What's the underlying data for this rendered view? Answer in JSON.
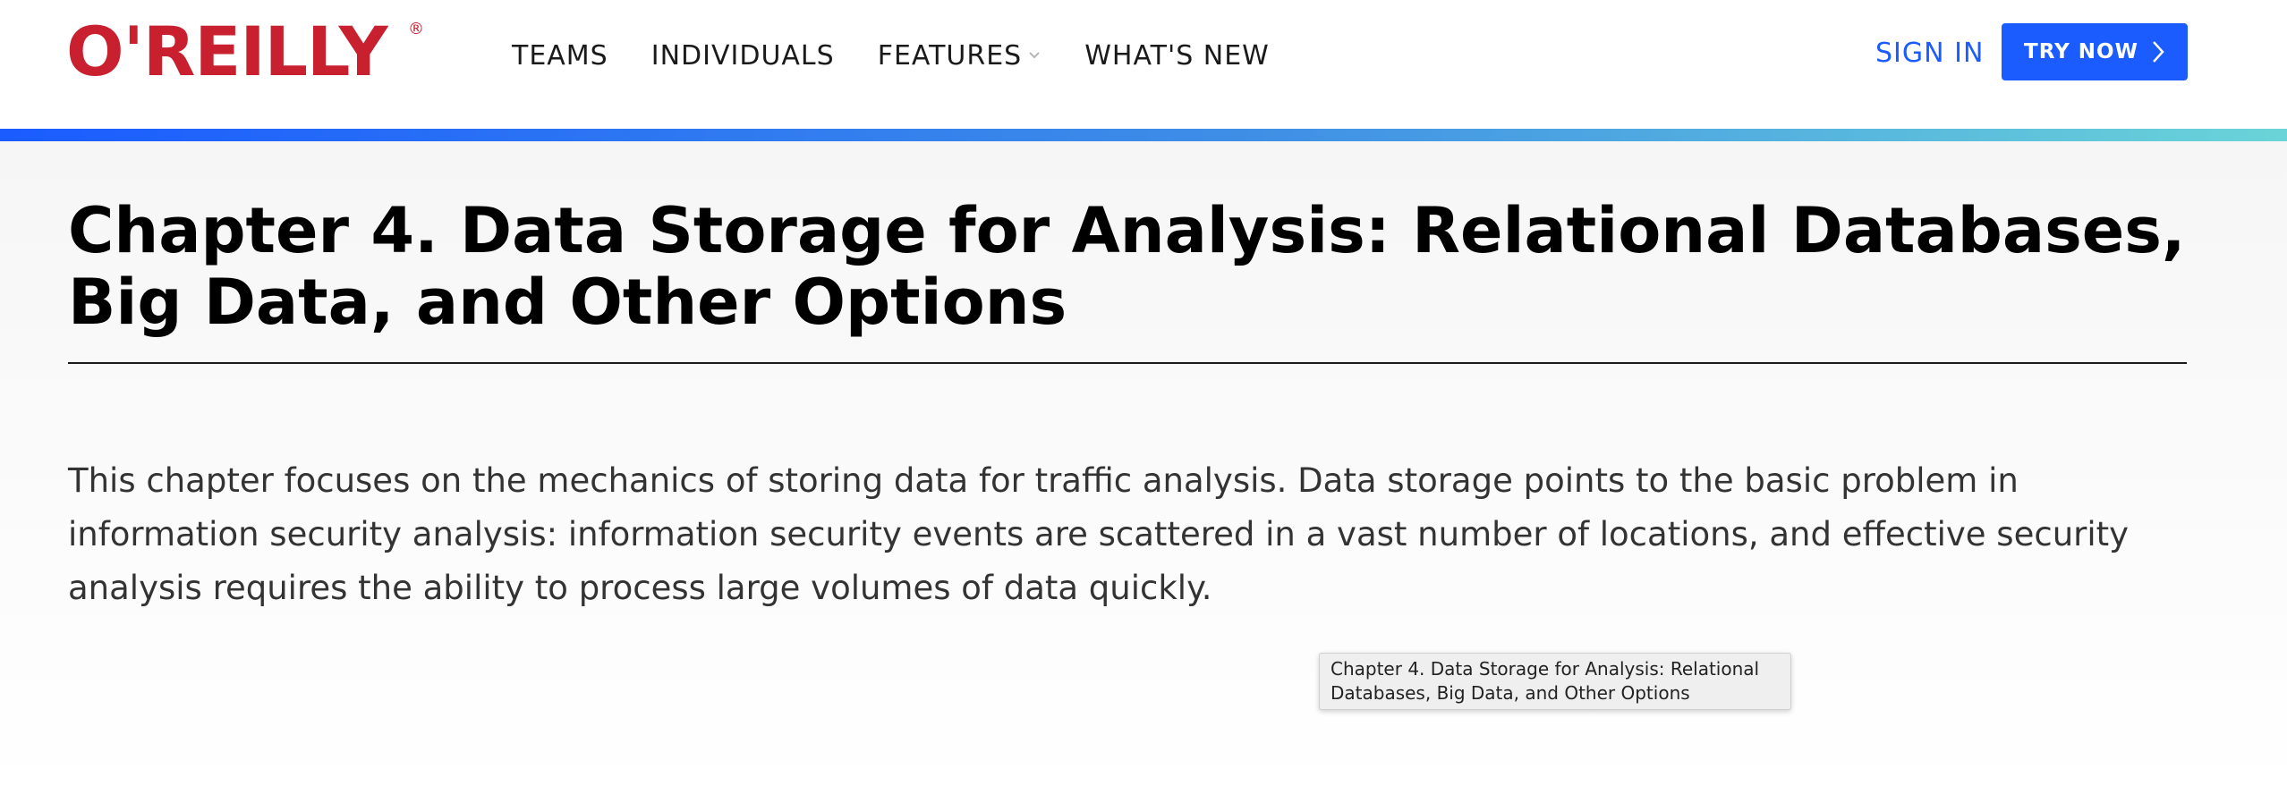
{
  "header": {
    "logo_text": "O'REILLY",
    "logo_registered": "®",
    "nav": [
      {
        "label": "TEAMS"
      },
      {
        "label": "INDIVIDUALS"
      },
      {
        "label": "FEATURES",
        "has_dropdown": true
      },
      {
        "label": "WHAT'S NEW"
      }
    ],
    "sign_in_label": "SIGN IN",
    "try_now_label": "TRY NOW"
  },
  "colors": {
    "brand_red": "#c8202f",
    "accent_blue": "#1a5cff",
    "gradient_end": "#6ad4d8"
  },
  "icons": {
    "dropdown": "chevron-down-icon",
    "try_now": "chevron-right-icon"
  },
  "main": {
    "title": "Chapter 4. Data Storage for Analysis: Relational Databases, Big Data, and Other Options",
    "intro": "This chapter focuses on the mechanics of storing data for traffic analysis. Data storage points to the basic problem in information security analysis: information security events are scattered in a vast number of locations, and effective security analysis requires the ability to process large volumes of data quickly."
  },
  "tooltip": {
    "text": "Chapter 4. Data Storage for Analysis: Relational Databases, Big Data, and Other Options"
  }
}
